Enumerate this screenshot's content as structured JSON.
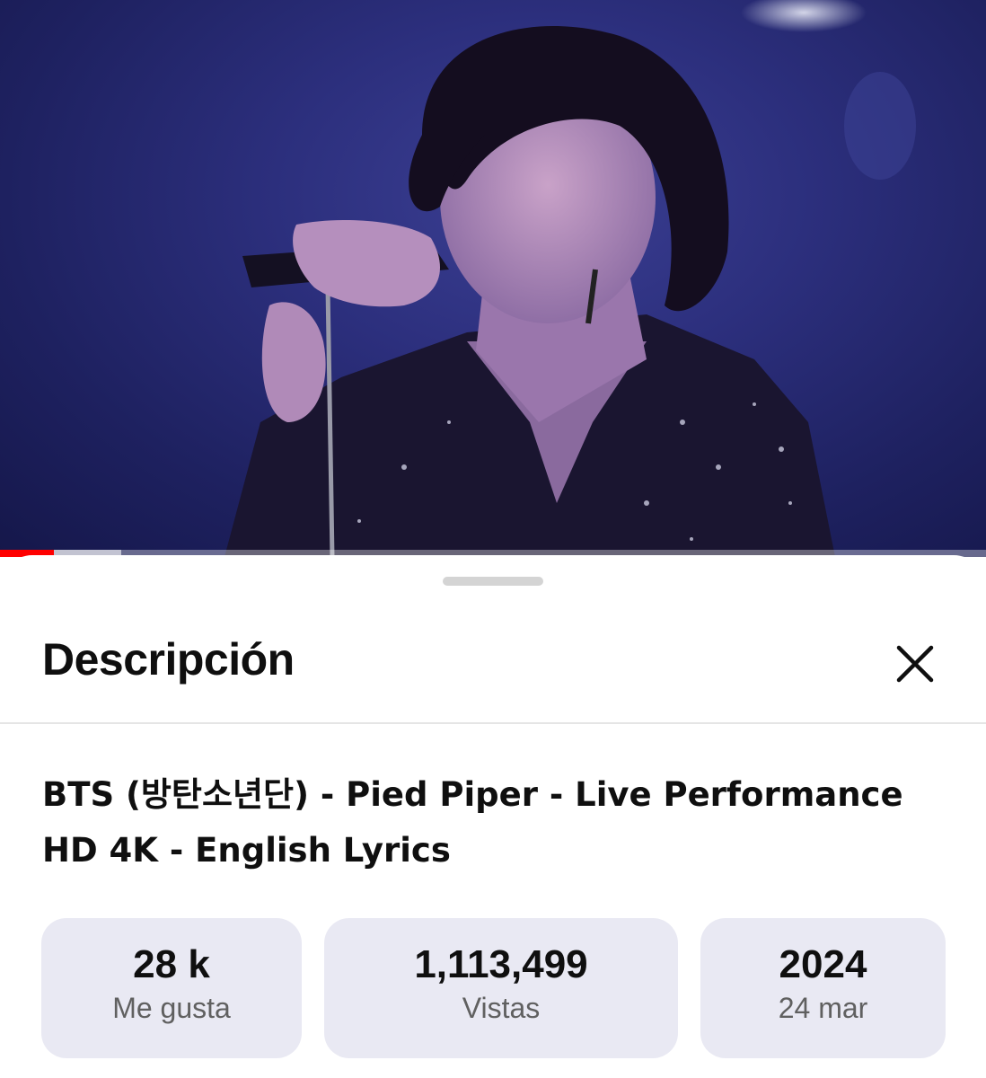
{
  "video": {
    "progress_fraction": 0.055,
    "buffer_fraction": 0.123
  },
  "sheet": {
    "title": "Descripción"
  },
  "details": {
    "video_title": "BTS (방탄소년단) - Pied Piper - Live Performance HD 4K - English Lyrics",
    "stats": [
      {
        "value": "28 k",
        "label": "Me gusta"
      },
      {
        "value": "1,113,499",
        "label": "Vistas"
      },
      {
        "value": "2024",
        "label": "24 mar"
      }
    ]
  },
  "colors": {
    "progress": "#ff0000",
    "stat_bg": "#e9e9f3",
    "text_primary": "#0f0f0f",
    "text_secondary": "#606060"
  },
  "icons": {
    "close": "close-icon"
  }
}
